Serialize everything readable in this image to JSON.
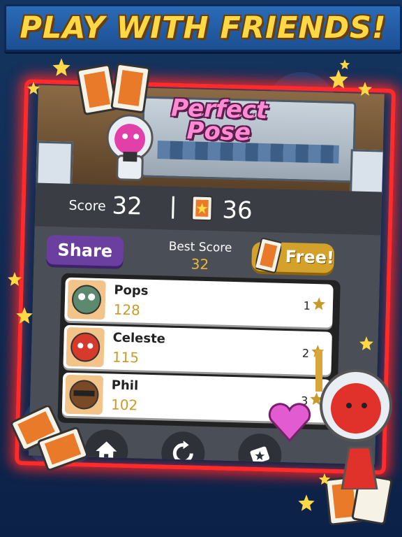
{
  "banner": {
    "title": "PLAY WITH FRIENDS!"
  },
  "game": {
    "logo_line1": "Perfect",
    "logo_line2": "Pose"
  },
  "score_bar": {
    "score_label": "Score",
    "score_value": "32",
    "tickets_value": "36"
  },
  "actions": {
    "share_label": "Share",
    "best_label": "Best Score",
    "best_value": "32",
    "free_label": "Free!"
  },
  "leaderboard": [
    {
      "name": "Pops",
      "score": "128",
      "rank": "1"
    },
    {
      "name": "Celeste",
      "score": "115",
      "rank": "2"
    },
    {
      "name": "Phil",
      "score": "102",
      "rank": "3"
    }
  ],
  "nav": [
    {
      "icon": "home-icon"
    },
    {
      "icon": "replay-icon"
    },
    {
      "icon": "ticket-icon"
    }
  ],
  "colors": {
    "accent_gold": "#f0b637",
    "share_purple": "#6b3fa0",
    "glow_red": "#ff2a2a",
    "banner_text": "#ffd845"
  }
}
